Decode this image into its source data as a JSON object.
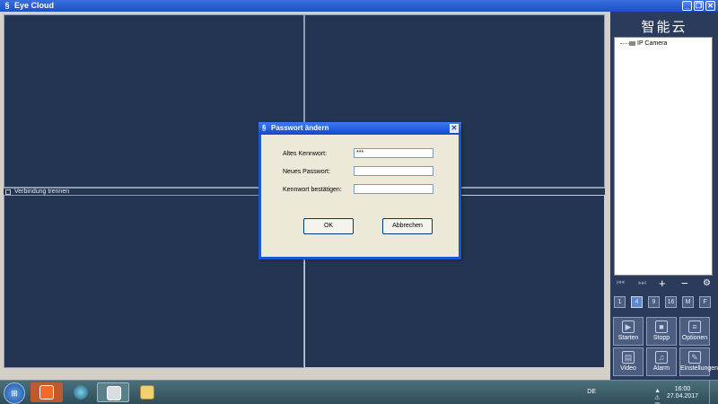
{
  "window": {
    "title": "Eye Cloud",
    "app_icon": "app-logo-icon",
    "controls": [
      "minimize-icon",
      "restore-icon",
      "close-icon"
    ]
  },
  "main": {
    "connection_label": "Verbindung trennen"
  },
  "right_panel": {
    "brand": "智能云",
    "tree": [
      {
        "label": "IP Camera",
        "icon": "camera-icon"
      }
    ],
    "nav_buttons": [
      "first-icon",
      "last-icon",
      "add-icon",
      "remove-icon",
      "settings-icon"
    ],
    "layout_buttons": [
      "1",
      "4",
      "9",
      "16",
      "M",
      "F"
    ],
    "action_buttons": [
      {
        "label": "Starten",
        "icon": "start-icon"
      },
      {
        "label": "Stopp",
        "icon": "stop-icon"
      },
      {
        "label": "Optionen",
        "icon": "options-icon"
      },
      {
        "label": "Video",
        "icon": "video-icon"
      },
      {
        "label": "Alarm",
        "icon": "bell-icon"
      },
      {
        "label": "Einstellungen",
        "icon": "tools-icon"
      }
    ]
  },
  "dialog": {
    "title": "Passwort ändern",
    "fields": [
      {
        "label": "Altes Kennwort:",
        "value": "***"
      },
      {
        "label": "Neues Passwort:",
        "value": ""
      },
      {
        "label": "Kennwort bestätigen:",
        "value": ""
      }
    ],
    "ok_label": "OK",
    "cancel_label": "Abbrechen"
  },
  "taskbar": {
    "language": "DE",
    "time": "16:00",
    "date": "27.04.2017"
  },
  "colors": {
    "workspace": "#243554",
    "title_bar": "#1d4fc4",
    "taskbar": "#3b5e68"
  }
}
